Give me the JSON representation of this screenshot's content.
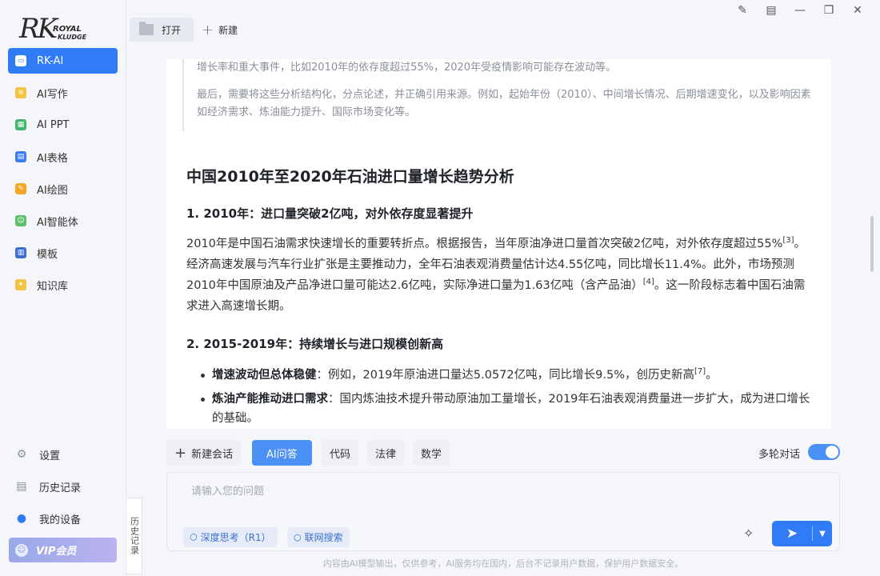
{
  "brand": {
    "logo_main": "RK",
    "logo_line1": "ROYAL",
    "logo_line2": "KLUDGE"
  },
  "sidebar": {
    "items": [
      {
        "label": "RK-AI",
        "icon": "chat-icon",
        "color": "#2f7cf6",
        "glyph": "▭"
      },
      {
        "label": "AI写作",
        "icon": "doc-icon",
        "color": "#f5c342",
        "glyph": "≡"
      },
      {
        "label": "AI PPT",
        "icon": "ppt-icon",
        "color": "#3fb86b",
        "glyph": "▦"
      },
      {
        "label": "AI表格",
        "icon": "sheet-icon",
        "color": "#3b7ef6",
        "glyph": "▤"
      },
      {
        "label": "AI绘图",
        "icon": "paint-icon",
        "color": "#f5a623",
        "glyph": "✎"
      },
      {
        "label": "AI智能体",
        "icon": "agent-icon",
        "color": "#5bc26a",
        "glyph": "☺"
      },
      {
        "label": "模板",
        "icon": "template-icon",
        "color": "#3b6fd6",
        "glyph": "▥"
      },
      {
        "label": "知识库",
        "icon": "bulb-icon",
        "color": "#f5c342",
        "glyph": "✦"
      }
    ],
    "bottom": [
      {
        "label": "设置",
        "icon": "gear-icon",
        "glyph": "⚙"
      },
      {
        "label": "历史记录",
        "icon": "history-icon",
        "glyph": "▤"
      },
      {
        "label": "我的设备",
        "icon": "device-icon",
        "glyph": "●"
      }
    ],
    "vip_label": "VIP会员",
    "history_tab": "历史记录"
  },
  "tabs": {
    "open_label": "打开",
    "new_label": "新建"
  },
  "window_controls": [
    "edit-icon",
    "feedback-icon",
    "minimize-icon",
    "restore-icon",
    "close-icon"
  ],
  "content": {
    "quote_p1": "增长率和重大事件，比如2010年的依存度超过55%，2020年受疫情影响可能存在波动等。",
    "quote_p2": "最后，需要将这些分析结构化，分点论述，并正确引用来源。例如，起始年份（2010）、中间增长情况、后期增速变化，以及影响因素如经济需求、炼油能力提升、国际市场变化等。",
    "title": "中国2010年至2020年石油进口量增长趋势分析",
    "section1_title": "1. 2010年：进口量突破2亿吨，对外依存度显著提升",
    "section1_p_a": "2010年是中国石油需求快速增长的重要转折点。根据报告，当年原油净进口量首次突破2亿吨，对外依存度超过55%",
    "section1_ref1": "[3]",
    "section1_p_b": "。经济高速发展与汽车行业扩张是主要推动力，全年石油表观消费量估计达4.55亿吨，同比增长11.4%。此外，市场预测2010年中国原油及产品净进口量可能达2.6亿吨，实际净进口量为1.63亿吨（含产品油）",
    "section1_ref2": "[4]",
    "section1_p_c": "。这一阶段标志着中国石油需求进入高速增长期。",
    "section2_title": "2. 2015-2019年：持续增长与进口规模创新高",
    "bullet1_bold": "增速波动但总体稳健",
    "bullet1_text": "：例如，2019年原油进口量达5.0572亿吨，同比增长9.5%，创历史新高",
    "bullet1_ref": "[7]",
    "bullet1_end": "。",
    "bullet2_bold": "炼油产能推动进口需求",
    "bullet2_text": "：国内炼油技术提升带动原油加工量增长，2019年石油表观消费量进一步扩大，成为进口增长的基础。"
  },
  "toolbar": {
    "new_chat": "新建会话",
    "modes": [
      "AI问答",
      "代码",
      "法律",
      "数学"
    ],
    "multi_turn": "多轮对话",
    "multi_turn_on": true
  },
  "input": {
    "placeholder": "请输入您的问题",
    "chip_deep": "深度思考（R1）",
    "chip_web": "联网搜索"
  },
  "footer": "内容由AI模型输出，仅供参考，AI服务均在国内，后台不记录用户数据，保护用户数据安全。"
}
